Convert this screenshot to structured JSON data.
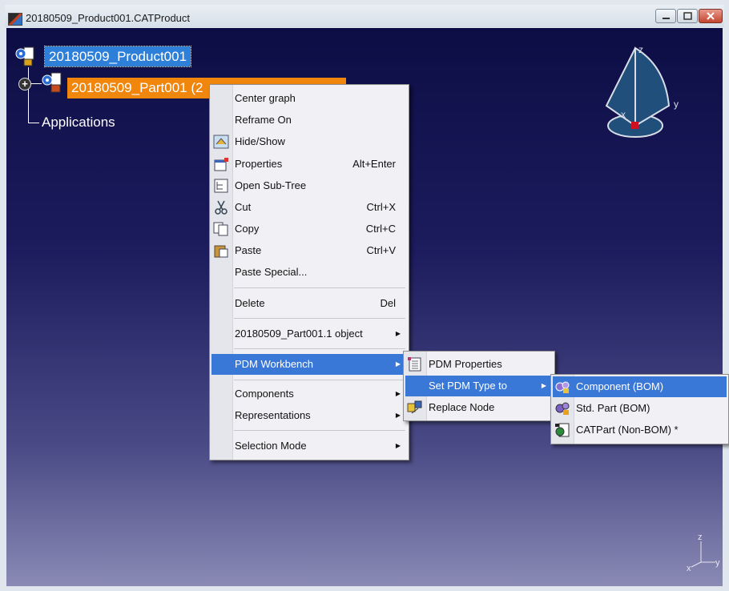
{
  "window": {
    "title": "20180509_Product001.CATProduct"
  },
  "tree": {
    "root_label": "20180509_Product001",
    "part_label": "20180509_Part001 (2",
    "applications_label": "Applications",
    "expander": "+"
  },
  "compass": {
    "x": "x",
    "y": "y",
    "z": "z"
  },
  "axes": {
    "x": "x",
    "y": "y",
    "z": "z"
  },
  "context_menu": {
    "center_graph": "Center graph",
    "reframe_on": "Reframe On",
    "hide_show": "Hide/Show",
    "properties": "Properties",
    "properties_sc": "Alt+Enter",
    "open_subtree": "Open Sub-Tree",
    "cut": "Cut",
    "cut_sc": "Ctrl+X",
    "copy": "Copy",
    "copy_sc": "Ctrl+C",
    "paste": "Paste",
    "paste_sc": "Ctrl+V",
    "paste_special": "Paste Special...",
    "delete": "Delete",
    "delete_sc": "Del",
    "object": "20180509_Part001.1 object",
    "pdm_workbench": "PDM Workbench",
    "components": "Components",
    "representations": "Representations",
    "selection_mode": "Selection Mode"
  },
  "pdm_menu": {
    "pdm_properties": "PDM Properties",
    "set_pdm_type": "Set PDM Type to",
    "replace_node": "Replace Node"
  },
  "type_menu": {
    "component": "Component (BOM)",
    "std_part": "Std. Part (BOM)",
    "catpart": "CATPart (Non-BOM) *"
  },
  "colors": {
    "highlight": "#3a78d8",
    "selection_orange": "#f0860c",
    "root_selection": "#2d7fd8"
  }
}
